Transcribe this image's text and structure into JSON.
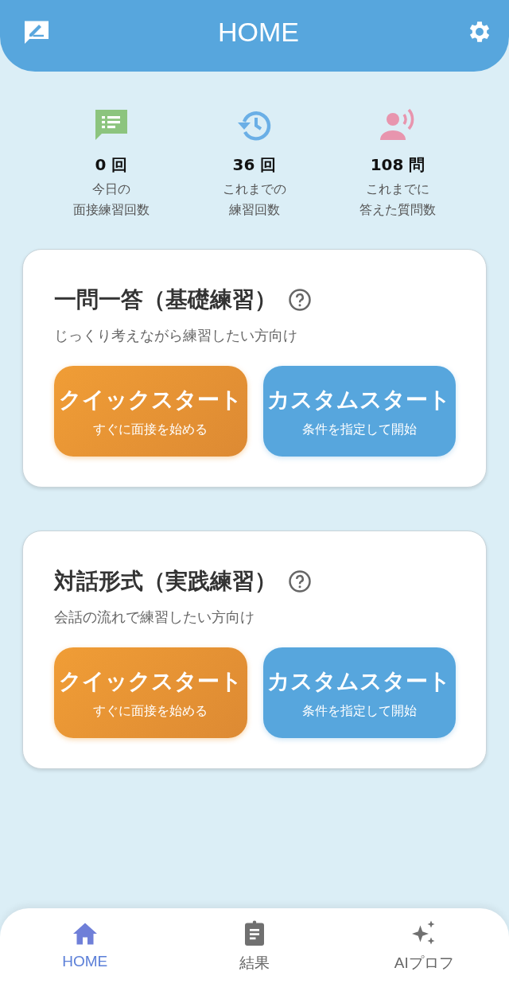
{
  "header": {
    "title": "HOME"
  },
  "stats": [
    {
      "kind": "today",
      "value": "0 回",
      "label_lines": [
        "今日の",
        "面接練習回数"
      ]
    },
    {
      "kind": "history",
      "value": "36 回",
      "label_lines": [
        "これまでの",
        "練習回数"
      ]
    },
    {
      "kind": "questions",
      "value": "108 問",
      "label_lines": [
        "これまでに",
        "答えた質問数"
      ]
    }
  ],
  "modes": [
    {
      "title": "一問一答（基礎練習）",
      "description": "じっくり考えながら練習したい方向け",
      "buttons": [
        {
          "kind": "quick",
          "label": "クイックスタート",
          "sublabel": "すぐに面接を始める"
        },
        {
          "kind": "custom",
          "label": "カスタムスタート",
          "sublabel": "条件を指定して開始"
        }
      ]
    },
    {
      "title": "対話形式（実践練習）",
      "description": "会話の流れで練習したい方向け",
      "buttons": [
        {
          "kind": "quick",
          "label": "クイックスタート",
          "sublabel": "すぐに面接を始める"
        },
        {
          "kind": "custom",
          "label": "カスタムスタート",
          "sublabel": "条件を指定して開始"
        }
      ]
    }
  ],
  "nav": [
    {
      "kind": "home",
      "label": "HOME",
      "selected": true
    },
    {
      "kind": "results",
      "label": "結果",
      "selected": false
    },
    {
      "kind": "ai",
      "label": "AIプロフ",
      "selected": false
    }
  ]
}
